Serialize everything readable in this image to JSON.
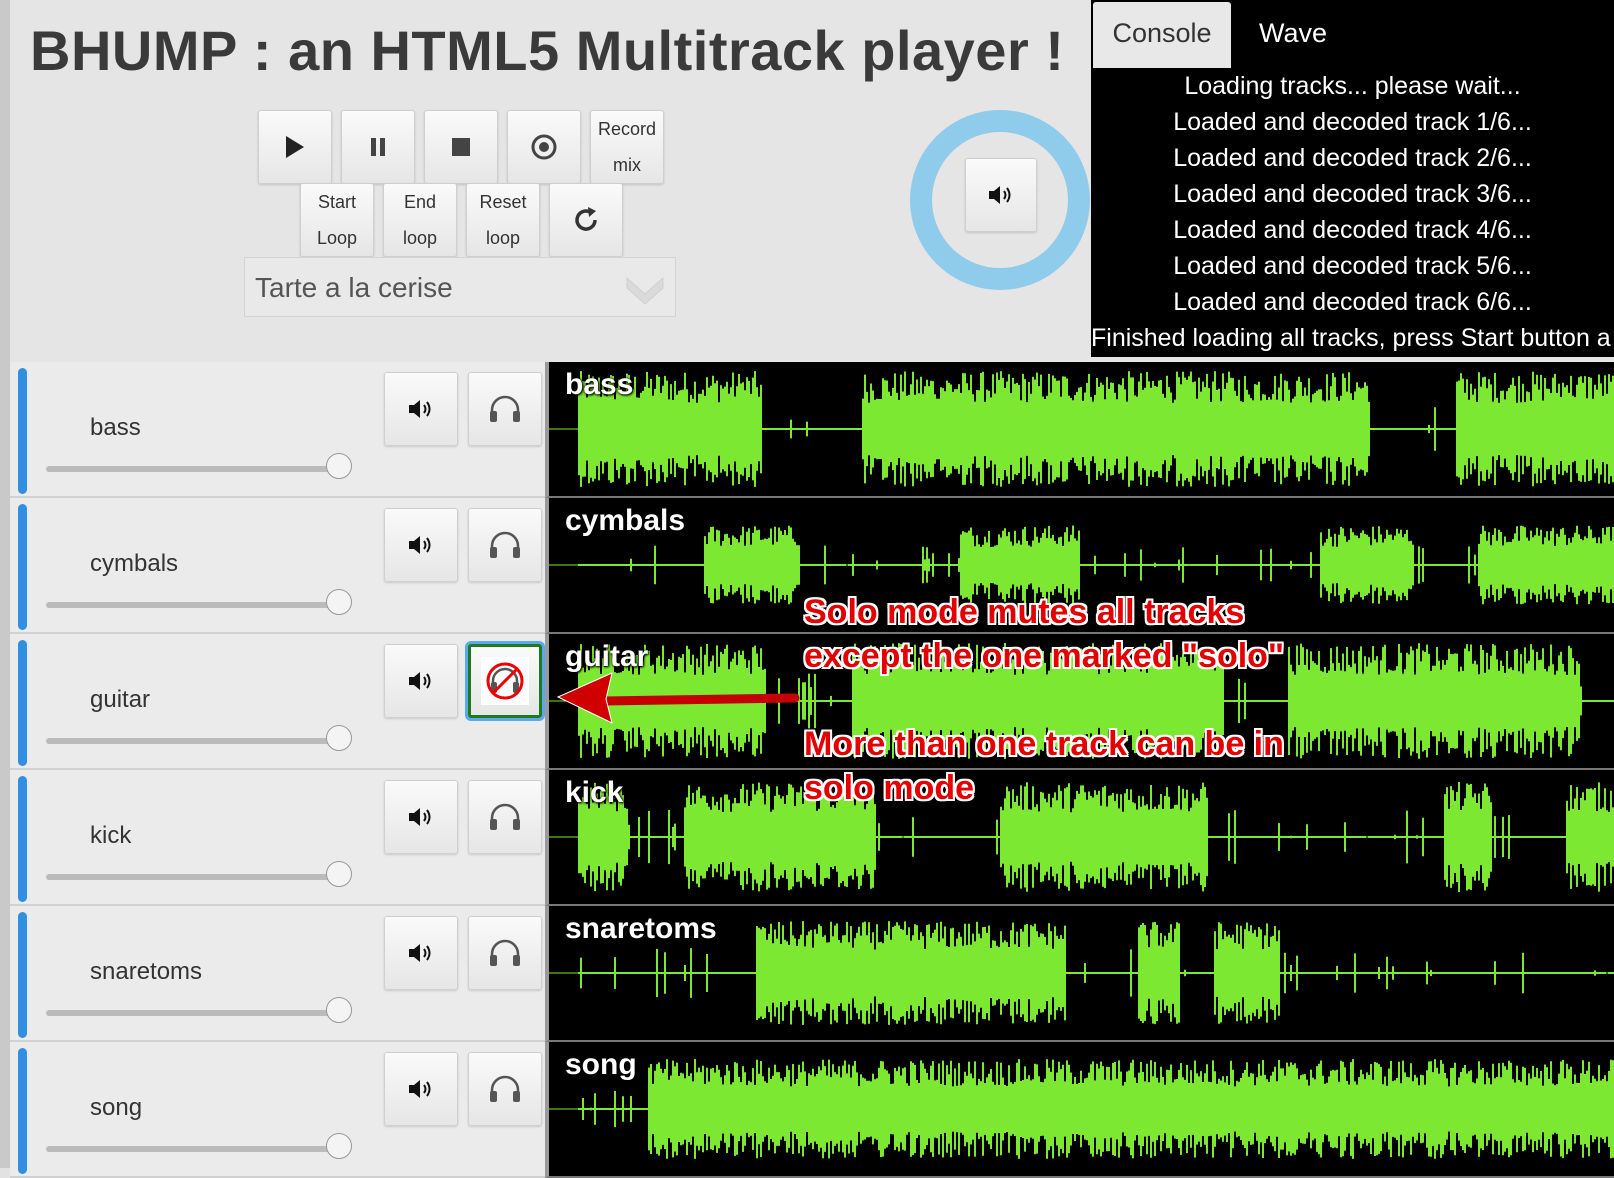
{
  "app": {
    "title": "BHUMP : an HTML5 Multitrack player !"
  },
  "transport": {
    "play_icon": "play-icon",
    "pause_icon": "pause-icon",
    "stop_icon": "stop-icon",
    "record_icon": "record-icon",
    "record_mix_line1": "Record",
    "record_mix_line2": "mix",
    "start_loop_line1": "Start",
    "start_loop_line2": "Loop",
    "end_loop_line1": "End",
    "end_loop_line2": "loop",
    "reset_loop_line1": "Reset",
    "reset_loop_line2": "loop",
    "replay_icon": "refresh-icon"
  },
  "song_select": {
    "selected": "Tarte a la cerise"
  },
  "master": {
    "icon": "volume-icon",
    "ring_color": "#8fcbea"
  },
  "console": {
    "tabs": [
      {
        "label": "Console",
        "active": true
      },
      {
        "label": "Wave",
        "active": false
      }
    ],
    "lines": [
      "Loading tracks... please wait...",
      "Loaded and decoded track 1/6...",
      "Loaded and decoded track 2/6...",
      "Loaded and decoded track 3/6...",
      "Loaded and decoded track 4/6...",
      "Loaded and decoded track 5/6...",
      "Loaded and decoded track 6/6...",
      "Finished loading all tracks, press Start button a"
    ]
  },
  "tracks": [
    {
      "name": "bass",
      "solo": false,
      "volume": 1.0
    },
    {
      "name": "cymbals",
      "solo": false,
      "volume": 1.0
    },
    {
      "name": "guitar",
      "solo": true,
      "volume": 1.0
    },
    {
      "name": "kick",
      "solo": false,
      "volume": 1.0
    },
    {
      "name": "snaretoms",
      "solo": false,
      "volume": 1.0
    },
    {
      "name": "song",
      "solo": false,
      "volume": 1.0
    }
  ],
  "colors": {
    "wave": "#7de832",
    "track_bar": "#2f8fe0",
    "annotation": "#e40000"
  },
  "annotation": {
    "line1": "Solo mode mutes all tracks",
    "line2": "except the one marked \"solo\"",
    "line3": "More than one track can be in",
    "line4": "solo mode"
  }
}
